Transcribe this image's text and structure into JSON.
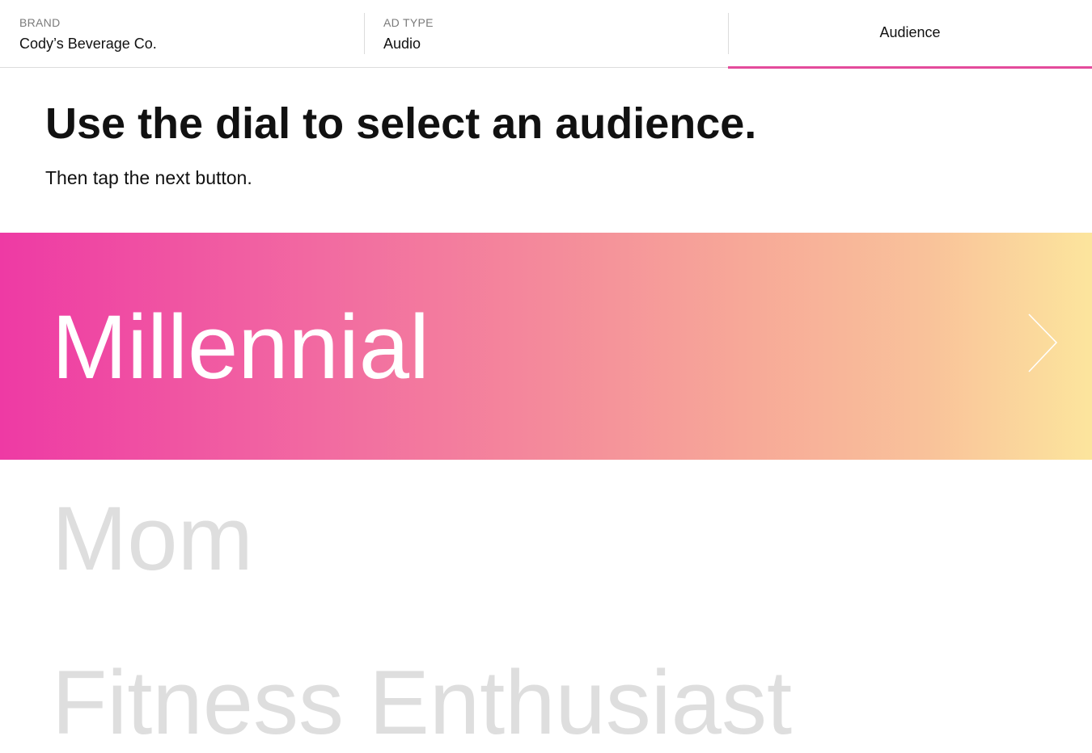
{
  "header": {
    "steps": [
      {
        "label": "BRAND",
        "value": "Cody’s Beverage Co."
      },
      {
        "label": "AD TYPE",
        "value": "Audio"
      },
      {
        "label": "Audience"
      }
    ]
  },
  "main": {
    "title": "Use the dial to select an audience.",
    "subtitle": "Then tap the next button."
  },
  "dial": {
    "selected": "Millennial",
    "options": [
      "Mom",
      "Fitness Enthusiast"
    ],
    "next_icon": "chevron-right-icon"
  },
  "colors": {
    "accent": "#e44b9b",
    "gradient_start": "#ee3aa4",
    "gradient_end": "#fce59d",
    "muted_text": "#dedede"
  }
}
